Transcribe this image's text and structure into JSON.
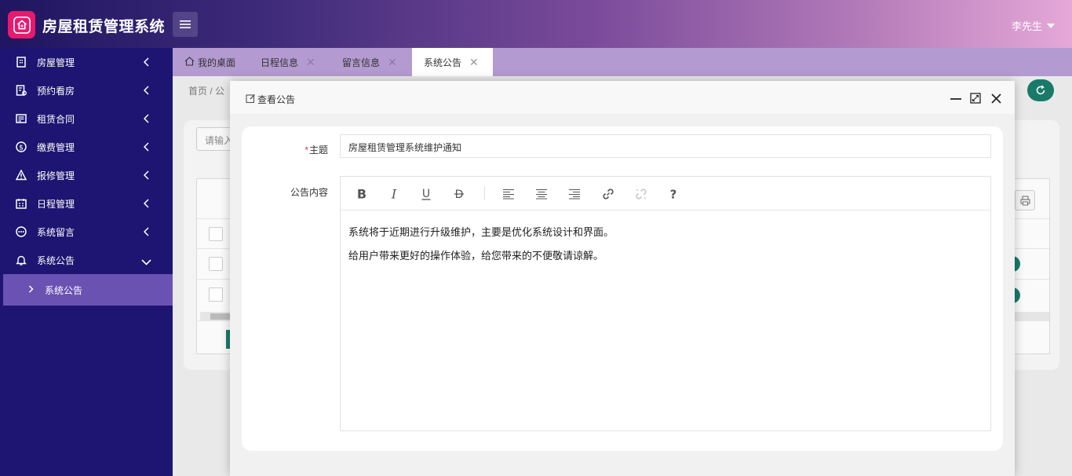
{
  "app": {
    "title": "房屋租赁管理系统",
    "user": "李先生"
  },
  "sidebar": {
    "items": [
      {
        "label": "房屋管理",
        "icon": "building-icon"
      },
      {
        "label": "预约看房",
        "icon": "appointment-icon"
      },
      {
        "label": "租赁合同",
        "icon": "contract-icon"
      },
      {
        "label": "缴费管理",
        "icon": "payment-icon"
      },
      {
        "label": "报修管理",
        "icon": "warning-icon"
      },
      {
        "label": "日程管理",
        "icon": "calendar-icon"
      },
      {
        "label": "系统留言",
        "icon": "message-icon"
      },
      {
        "label": "系统公告",
        "icon": "bell-icon"
      }
    ],
    "sub_item": "系统公告"
  },
  "tabs": [
    {
      "label": "我的桌面"
    },
    {
      "label": "日程信息"
    },
    {
      "label": "留言信息"
    },
    {
      "label": "系统公告"
    }
  ],
  "background": {
    "breadcrumb": "首页  /  公",
    "search_placeholder": "请输入"
  },
  "dialog": {
    "title": "查看公告",
    "subject_label": "主题",
    "subject_required_mark": "*",
    "subject_value": "房屋租赁管理系统维护通知",
    "content_label": "公告内容",
    "content_lines": [
      "系统将于近期进行升级维护，主要是优化系统设计和界面。",
      "给用户带来更好的操作体验，给您带来的不便敬请谅解。"
    ]
  },
  "colors": {
    "sidebar_bg": "#1d1571",
    "sidebar_active": "#6a52b3",
    "logo": "#e8196f",
    "accent_teal": "#1a7a6a"
  }
}
